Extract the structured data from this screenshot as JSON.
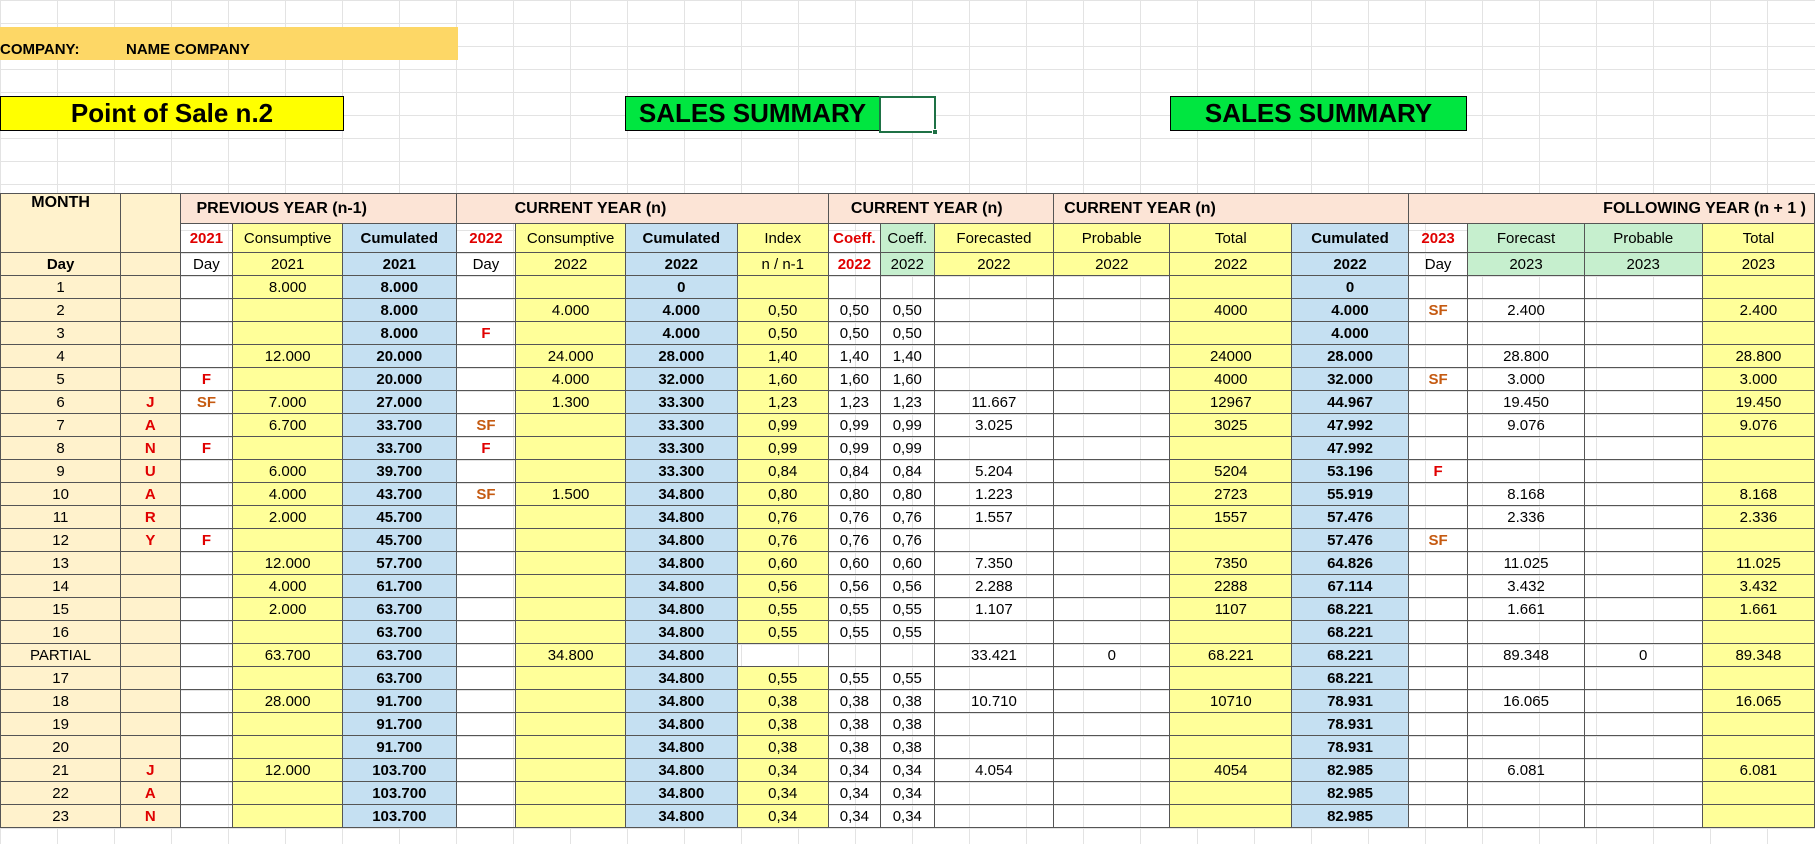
{
  "company": {
    "label": "COMPANY:",
    "name": "NAME COMPANY"
  },
  "titles": {
    "pos": "Point of Sale n.2",
    "sales_summary_1": "SALES SUMMARY",
    "sales_summary_2": "SALES SUMMARY"
  },
  "colors": {
    "company_bar": "#fdd766",
    "pos_title": "#ffff00",
    "sales_summary": "#00e640",
    "cumulated_blue": "#c5e0f2",
    "yellow_col": "#ffff99",
    "peach_header": "#fce4d6",
    "green_header": "#c6efce",
    "selection": "#1e7145"
  },
  "headers": {
    "month": "MONTH",
    "prev_year": "PREVIOUS YEAR (n-1)",
    "curr_year_1": "CURRENT YEAR (n)",
    "curr_year_2": "CURRENT YEAR (n)",
    "curr_year_3": "CURRENT YEAR (n)",
    "following_year": "FOLLOWING YEAR  (n + 1 )",
    "row2": [
      "2021",
      "Consumptive",
      "Cumulated",
      "2022",
      "Consumptive",
      "Cumulated",
      "Index",
      "Coeff.",
      "Coeff.",
      "Forecasted",
      "Probable",
      "Total",
      "Cumulated",
      "2023",
      "Forecast",
      "Probable",
      "Total"
    ],
    "row3": [
      "Day",
      "",
      "Day",
      "2021",
      "2021",
      "Day",
      "2022",
      "2022",
      "n / n-1",
      "2022",
      "2022",
      "2022",
      "2022",
      "2022",
      "2022",
      "Day",
      "2023",
      "2023",
      "2023"
    ]
  },
  "rows": [
    {
      "day": "1",
      "m": "",
      "f21": "",
      "cons21": "8.000",
      "cum21": "8.000",
      "f22": "",
      "cons22": "",
      "cum22": "0",
      "idx": "",
      "co1": "",
      "co2": "",
      "fore": "",
      "prob": "",
      "tot": "",
      "cumt": "0",
      "f23": "",
      "fc23": "",
      "pr23": "",
      "tt23": ""
    },
    {
      "day": "2",
      "m": "",
      "f21": "",
      "cons21": "",
      "cum21": "8.000",
      "f22": "",
      "cons22": "4.000",
      "cum22": "4.000",
      "idx": "0,50",
      "co1": "0,50",
      "co2": "0,50",
      "fore": "",
      "prob": "",
      "tot": "4000",
      "cumt": "4.000",
      "f23": "SF",
      "fc23": "2.400",
      "pr23": "",
      "tt23": "2.400"
    },
    {
      "day": "3",
      "m": "",
      "f21": "",
      "cons21": "",
      "cum21": "8.000",
      "f22": "F",
      "cons22": "",
      "cum22": "4.000",
      "idx": "0,50",
      "co1": "0,50",
      "co2": "0,50",
      "fore": "",
      "prob": "",
      "tot": "",
      "cumt": "4.000",
      "f23": "",
      "fc23": "",
      "pr23": "",
      "tt23": ""
    },
    {
      "day": "4",
      "m": "",
      "f21": "",
      "cons21": "12.000",
      "cum21": "20.000",
      "f22": "",
      "cons22": "24.000",
      "cum22": "28.000",
      "idx": "1,40",
      "co1": "1,40",
      "co2": "1,40",
      "fore": "",
      "prob": "",
      "tot": "24000",
      "cumt": "28.000",
      "f23": "",
      "fc23": "28.800",
      "pr23": "",
      "tt23": "28.800"
    },
    {
      "day": "5",
      "m": "",
      "f21": "F",
      "cons21": "",
      "cum21": "20.000",
      "f22": "",
      "cons22": "4.000",
      "cum22": "32.000",
      "idx": "1,60",
      "co1": "1,60",
      "co2": "1,60",
      "fore": "",
      "prob": "",
      "tot": "4000",
      "cumt": "32.000",
      "f23": "SF",
      "fc23": "3.000",
      "pr23": "",
      "tt23": "3.000"
    },
    {
      "day": "6",
      "m": "J",
      "f21": "SF",
      "cons21": "7.000",
      "cum21": "27.000",
      "f22": "",
      "cons22": "1.300",
      "cum22": "33.300",
      "idx": "1,23",
      "co1": "1,23",
      "co2": "1,23",
      "fore": "11.667",
      "prob": "",
      "tot": "12967",
      "cumt": "44.967",
      "f23": "",
      "fc23": "19.450",
      "pr23": "",
      "tt23": "19.450"
    },
    {
      "day": "7",
      "m": "A",
      "f21": "",
      "cons21": "6.700",
      "cum21": "33.700",
      "f22": "SF",
      "cons22": "",
      "cum22": "33.300",
      "idx": "0,99",
      "co1": "0,99",
      "co2": "0,99",
      "fore": "3.025",
      "prob": "",
      "tot": "3025",
      "cumt": "47.992",
      "f23": "",
      "fc23": "9.076",
      "pr23": "",
      "tt23": "9.076"
    },
    {
      "day": "8",
      "m": "N",
      "f21": "F",
      "cons21": "",
      "cum21": "33.700",
      "f22": "F",
      "cons22": "",
      "cum22": "33.300",
      "idx": "0,99",
      "co1": "0,99",
      "co2": "0,99",
      "fore": "",
      "prob": "",
      "tot": "",
      "cumt": "47.992",
      "f23": "",
      "fc23": "",
      "pr23": "",
      "tt23": ""
    },
    {
      "day": "9",
      "m": "U",
      "f21": "",
      "cons21": "6.000",
      "cum21": "39.700",
      "f22": "",
      "cons22": "",
      "cum22": "33.300",
      "idx": "0,84",
      "co1": "0,84",
      "co2": "0,84",
      "fore": "5.204",
      "prob": "",
      "tot": "5204",
      "cumt": "53.196",
      "f23": "F",
      "fc23": "",
      "pr23": "",
      "tt23": ""
    },
    {
      "day": "10",
      "m": "A",
      "f21": "",
      "cons21": "4.000",
      "cum21": "43.700",
      "f22": "SF",
      "cons22": "1.500",
      "cum22": "34.800",
      "idx": "0,80",
      "co1": "0,80",
      "co2": "0,80",
      "fore": "1.223",
      "prob": "",
      "tot": "2723",
      "cumt": "55.919",
      "f23": "",
      "fc23": "8.168",
      "pr23": "",
      "tt23": "8.168"
    },
    {
      "day": "11",
      "m": "R",
      "f21": "",
      "cons21": "2.000",
      "cum21": "45.700",
      "f22": "",
      "cons22": "",
      "cum22": "34.800",
      "idx": "0,76",
      "co1": "0,76",
      "co2": "0,76",
      "fore": "1.557",
      "prob": "",
      "tot": "1557",
      "cumt": "57.476",
      "f23": "",
      "fc23": "2.336",
      "pr23": "",
      "tt23": "2.336"
    },
    {
      "day": "12",
      "m": "Y",
      "f21": "F",
      "cons21": "",
      "cum21": "45.700",
      "f22": "",
      "cons22": "",
      "cum22": "34.800",
      "idx": "0,76",
      "co1": "0,76",
      "co2": "0,76",
      "fore": "",
      "prob": "",
      "tot": "",
      "cumt": "57.476",
      "f23": "SF",
      "fc23": "",
      "pr23": "",
      "tt23": ""
    },
    {
      "day": "13",
      "m": "",
      "f21": "",
      "cons21": "12.000",
      "cum21": "57.700",
      "f22": "",
      "cons22": "",
      "cum22": "34.800",
      "idx": "0,60",
      "co1": "0,60",
      "co2": "0,60",
      "fore": "7.350",
      "prob": "",
      "tot": "7350",
      "cumt": "64.826",
      "f23": "",
      "fc23": "11.025",
      "pr23": "",
      "tt23": "11.025"
    },
    {
      "day": "14",
      "m": "",
      "f21": "",
      "cons21": "4.000",
      "cum21": "61.700",
      "f22": "",
      "cons22": "",
      "cum22": "34.800",
      "idx": "0,56",
      "co1": "0,56",
      "co2": "0,56",
      "fore": "2.288",
      "prob": "",
      "tot": "2288",
      "cumt": "67.114",
      "f23": "",
      "fc23": "3.432",
      "pr23": "",
      "tt23": "3.432"
    },
    {
      "day": "15",
      "m": "",
      "f21": "",
      "cons21": "2.000",
      "cum21": "63.700",
      "f22": "",
      "cons22": "",
      "cum22": "34.800",
      "idx": "0,55",
      "co1": "0,55",
      "co2": "0,55",
      "fore": "1.107",
      "prob": "",
      "tot": "1107",
      "cumt": "68.221",
      "f23": "",
      "fc23": "1.661",
      "pr23": "",
      "tt23": "1.661"
    },
    {
      "day": "16",
      "m": "",
      "f21": "",
      "cons21": "",
      "cum21": "63.700",
      "f22": "",
      "cons22": "",
      "cum22": "34.800",
      "idx": "0,55",
      "co1": "0,55",
      "co2": "0,55",
      "fore": "",
      "prob": "",
      "tot": "",
      "cumt": "68.221",
      "f23": "",
      "fc23": "",
      "pr23": "",
      "tt23": ""
    },
    {
      "day": "PARTIAL",
      "partial": true,
      "m": "",
      "f21": "",
      "cons21": "63.700",
      "cum21": "63.700",
      "f22": "",
      "cons22": "34.800",
      "cum22": "34.800",
      "idx": "",
      "co1": "",
      "co2": "",
      "fore": "33.421",
      "prob": "0",
      "tot": "68.221",
      "cumt": "68.221",
      "f23": "",
      "fc23": "89.348",
      "pr23": "0",
      "tt23": "89.348"
    },
    {
      "day": "17",
      "m": "",
      "f21": "",
      "cons21": "",
      "cum21": "63.700",
      "f22": "",
      "cons22": "",
      "cum22": "34.800",
      "idx": "0,55",
      "co1": "0,55",
      "co2": "0,55",
      "fore": "",
      "prob": "",
      "tot": "",
      "cumt": "68.221",
      "f23": "",
      "fc23": "",
      "pr23": "",
      "tt23": ""
    },
    {
      "day": "18",
      "m": "",
      "f21": "",
      "cons21": "28.000",
      "cum21": "91.700",
      "f22": "",
      "cons22": "",
      "cum22": "34.800",
      "idx": "0,38",
      "co1": "0,38",
      "co2": "0,38",
      "fore": "10.710",
      "prob": "",
      "tot": "10710",
      "cumt": "78.931",
      "f23": "",
      "fc23": "16.065",
      "pr23": "",
      "tt23": "16.065"
    },
    {
      "day": "19",
      "m": "",
      "f21": "",
      "cons21": "",
      "cum21": "91.700",
      "f22": "",
      "cons22": "",
      "cum22": "34.800",
      "idx": "0,38",
      "co1": "0,38",
      "co2": "0,38",
      "fore": "",
      "prob": "",
      "tot": "",
      "cumt": "78.931",
      "f23": "",
      "fc23": "",
      "pr23": "",
      "tt23": ""
    },
    {
      "day": "20",
      "m": "",
      "f21": "",
      "cons21": "",
      "cum21": "91.700",
      "f22": "",
      "cons22": "",
      "cum22": "34.800",
      "idx": "0,38",
      "co1": "0,38",
      "co2": "0,38",
      "fore": "",
      "prob": "",
      "tot": "",
      "cumt": "78.931",
      "f23": "",
      "fc23": "",
      "pr23": "",
      "tt23": ""
    },
    {
      "day": "21",
      "m": "J",
      "f21": "",
      "cons21": "12.000",
      "cum21": "103.700",
      "f22": "",
      "cons22": "",
      "cum22": "34.800",
      "idx": "0,34",
      "co1": "0,34",
      "co2": "0,34",
      "fore": "4.054",
      "prob": "",
      "tot": "4054",
      "cumt": "82.985",
      "f23": "",
      "fc23": "6.081",
      "pr23": "",
      "tt23": "6.081"
    },
    {
      "day": "22",
      "m": "A",
      "f21": "",
      "cons21": "",
      "cum21": "103.700",
      "f22": "",
      "cons22": "",
      "cum22": "34.800",
      "idx": "0,34",
      "co1": "0,34",
      "co2": "0,34",
      "fore": "",
      "prob": "",
      "tot": "",
      "cumt": "82.985",
      "f23": "",
      "fc23": "",
      "pr23": "",
      "tt23": ""
    },
    {
      "day": "23",
      "m": "N",
      "f21": "",
      "cons21": "",
      "cum21": "103.700",
      "f22": "",
      "cons22": "",
      "cum22": "34.800",
      "idx": "0,34",
      "co1": "0,34",
      "co2": "0,34",
      "fore": "",
      "prob": "",
      "tot": "",
      "cumt": "82.985",
      "f23": "",
      "fc23": "",
      "pr23": "",
      "tt23": ""
    }
  ]
}
